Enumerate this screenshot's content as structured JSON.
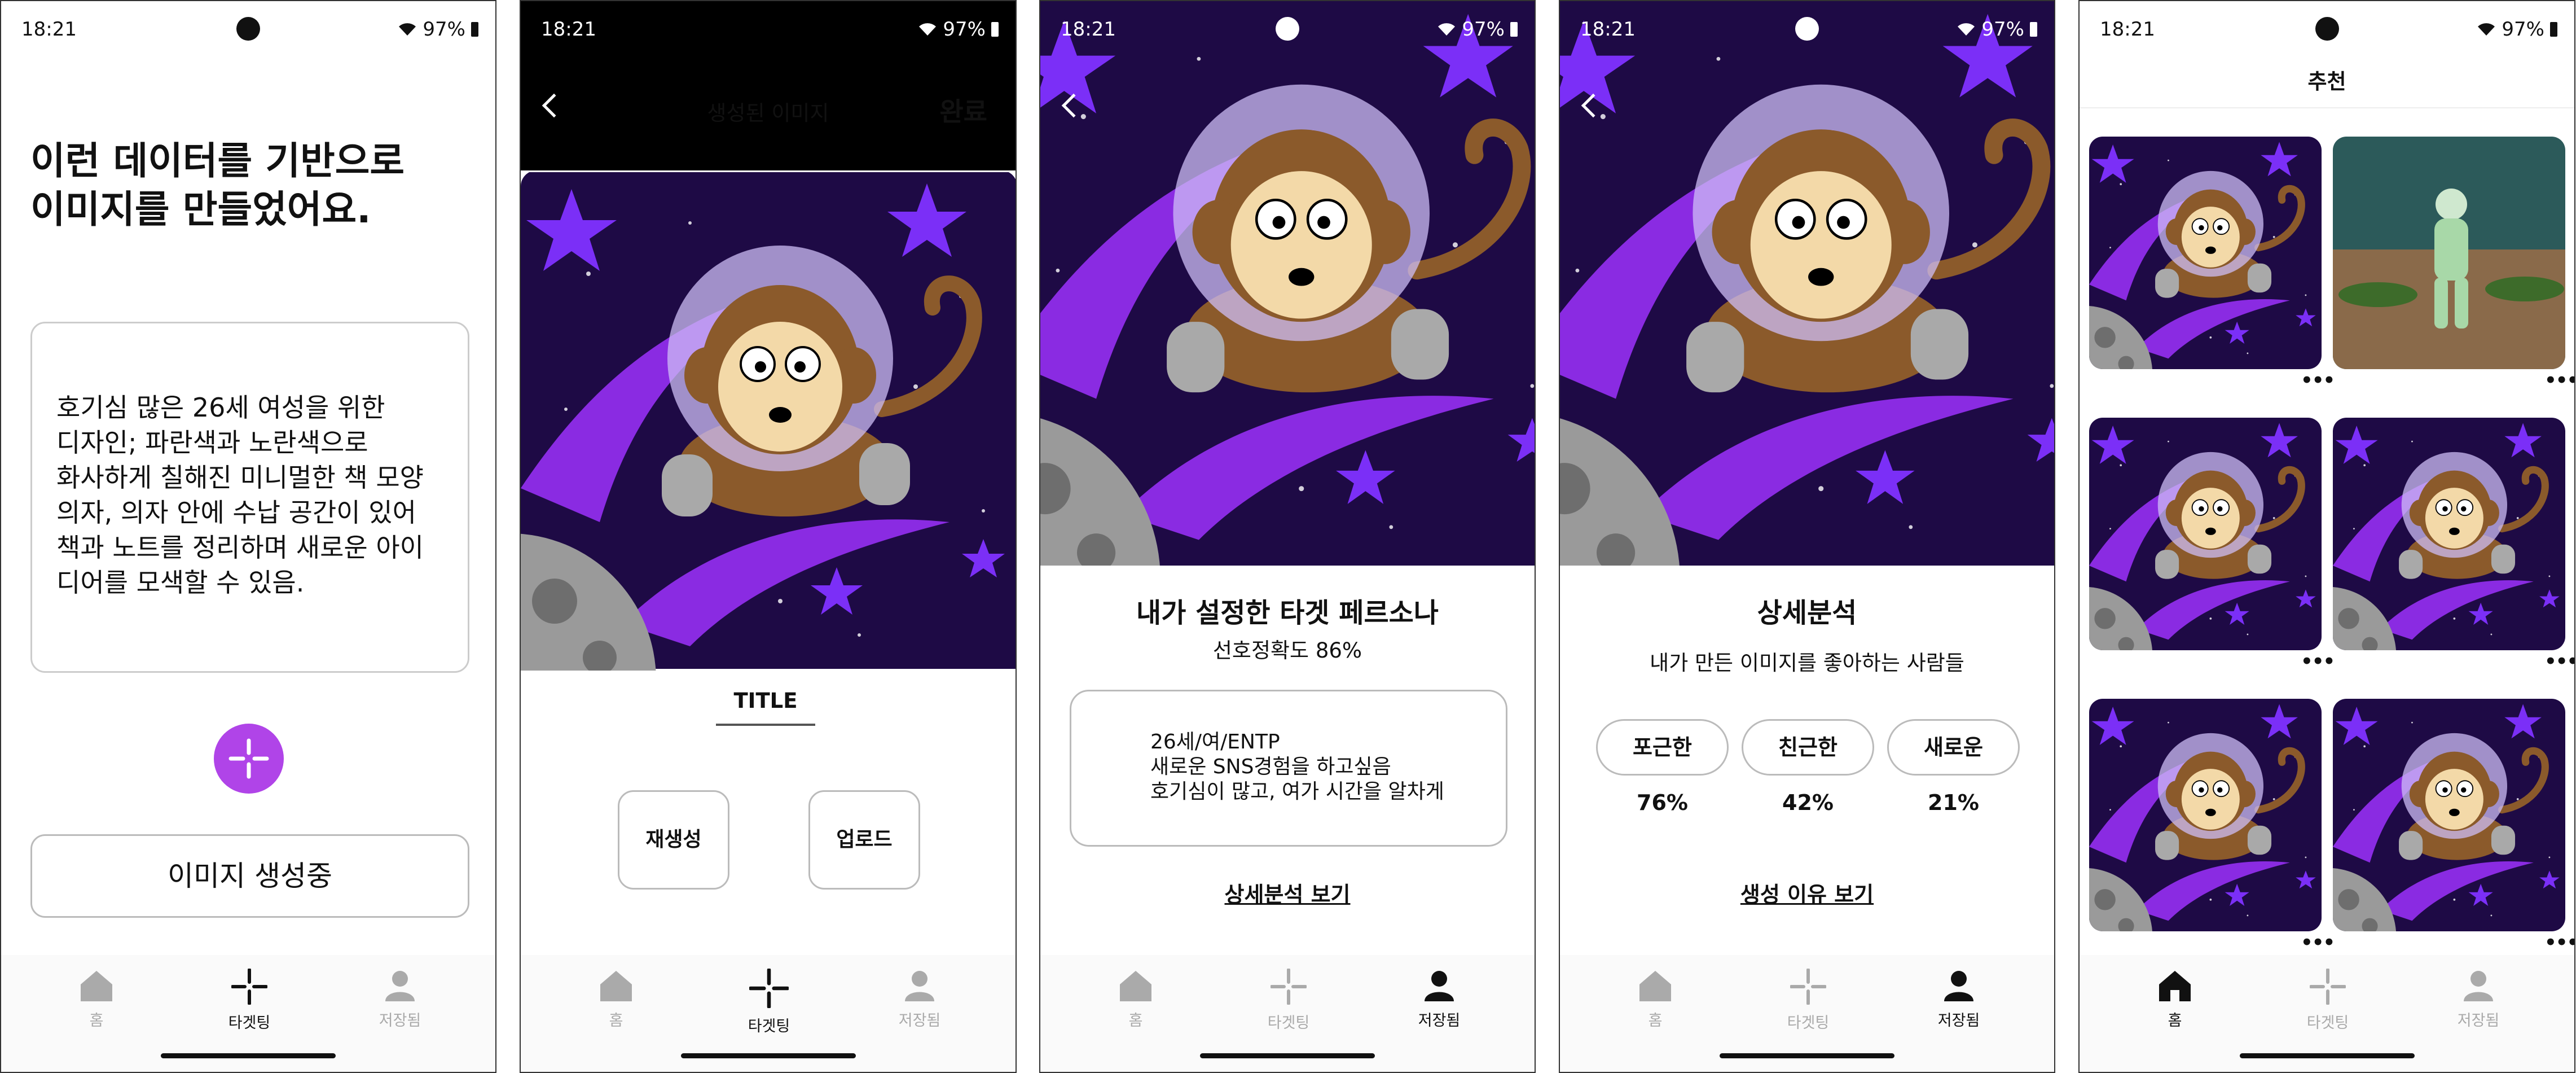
{
  "status": {
    "time": "18:21",
    "battery": "97%"
  },
  "nav": {
    "home": "홈",
    "targeting": "타겟팅",
    "saved": "저장됨"
  },
  "screen1": {
    "heading_line1": "이런 데이터를 기반으로",
    "heading_line2": "이미지를 만들었어요.",
    "prompt_lines": [
      "호기심 많은 26세 여성을 위한",
      "디자인; 파란색과 노란색으로",
      "화사하게 칠해진 미니멀한 책 모양",
      "의자, 의자 안에 수납 공간이 있어",
      "책과 노트를 정리하며 새로운 아이",
      "디어를 모색할 수 있음."
    ],
    "generating_button": "이미지 생성중"
  },
  "screen2": {
    "title": "생성된 이미지",
    "done": "완료",
    "tab": "TITLE",
    "regenerate": "재생성",
    "upload": "업로드"
  },
  "screen3": {
    "heading": "내가 설정한 타겟 페르소나",
    "accuracy": "선호정확도 86%",
    "persona_lines": [
      "26세/여/ENTP",
      "새로운 SNS경험을 하고싶음",
      "호기심이 많고, 여가 시간을 알차게"
    ],
    "link": "상세분석 보기"
  },
  "screen4": {
    "heading": "상세분석",
    "subheading": "내가 만든 이미지를 좋아하는 사람들",
    "traits": [
      {
        "label": "포근한",
        "percent": "76%"
      },
      {
        "label": "친근한",
        "percent": "42%"
      },
      {
        "label": "새로운",
        "percent": "21%"
      }
    ],
    "link": "생성 이유 보기"
  },
  "screen5": {
    "title": "추천",
    "more": "•••"
  },
  "colors": {
    "accent": "#b044e8",
    "art_bg": "#1e0a45",
    "art_purple": "#7b2ff7"
  }
}
